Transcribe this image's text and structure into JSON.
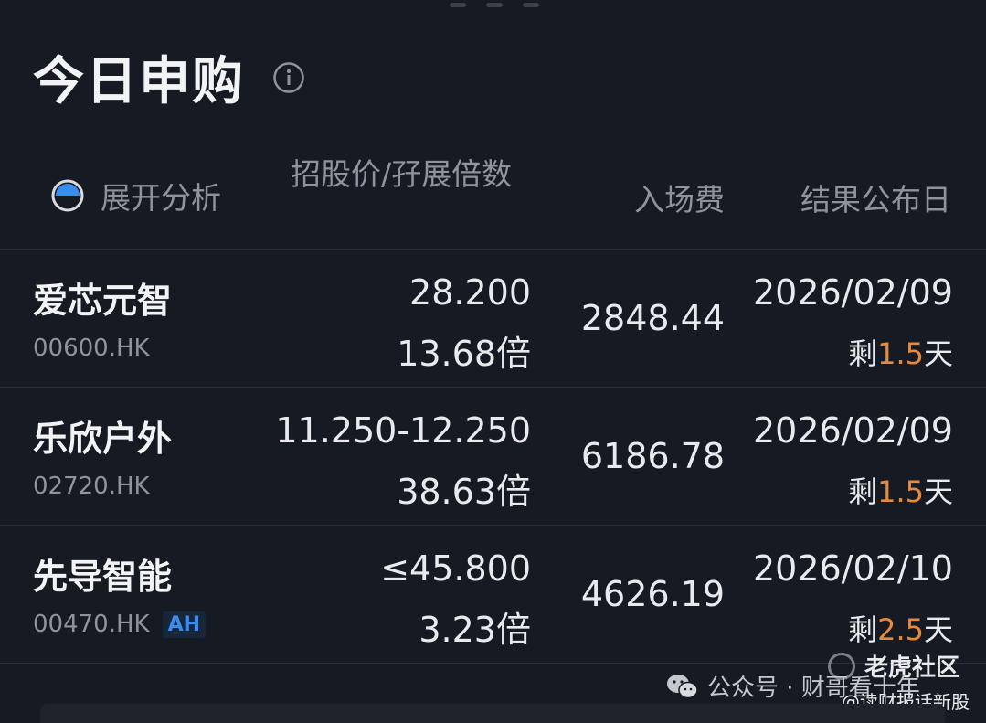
{
  "title": "今日申购",
  "header": {
    "expand_label": "展开分析",
    "col_price": "招股价/孖展倍数",
    "col_fee": "入场费",
    "col_date": "结果公布日"
  },
  "rows": [
    {
      "name": "爱芯元智",
      "code": "00600.HK",
      "badge": "",
      "price": "28.200",
      "multiple": "13.68倍",
      "fee": "2848.44",
      "date": "2026/02/09",
      "remain_prefix": "剩",
      "remain_num": "1.5",
      "remain_suffix": "天"
    },
    {
      "name": "乐欣户外",
      "code": "02720.HK",
      "badge": "",
      "price": "11.250-12.250",
      "multiple": "38.63倍",
      "fee": "6186.78",
      "date": "2026/02/09",
      "remain_prefix": "剩",
      "remain_num": "1.5",
      "remain_suffix": "天"
    },
    {
      "name": "先导智能",
      "code": "00470.HK",
      "badge": "AH",
      "price": "≤45.800",
      "multiple": "3.23倍",
      "fee": "4626.19",
      "date": "2026/02/10",
      "remain_prefix": "剩",
      "remain_num": "2.5",
      "remain_suffix": "天"
    }
  ],
  "watermark": {
    "brand": "老虎社区",
    "wechat": "公众号 · 财哥看十年",
    "handle": "@读财报话新股"
  },
  "colors": {
    "background": "#161a22",
    "accent_orange": "#e88a3c",
    "accent_blue": "#3a8cf0",
    "muted_text": "#8e939c"
  },
  "icons": [
    "info-icon",
    "pie-progress-icon",
    "tiger-ring-icon",
    "wechat-icon"
  ]
}
